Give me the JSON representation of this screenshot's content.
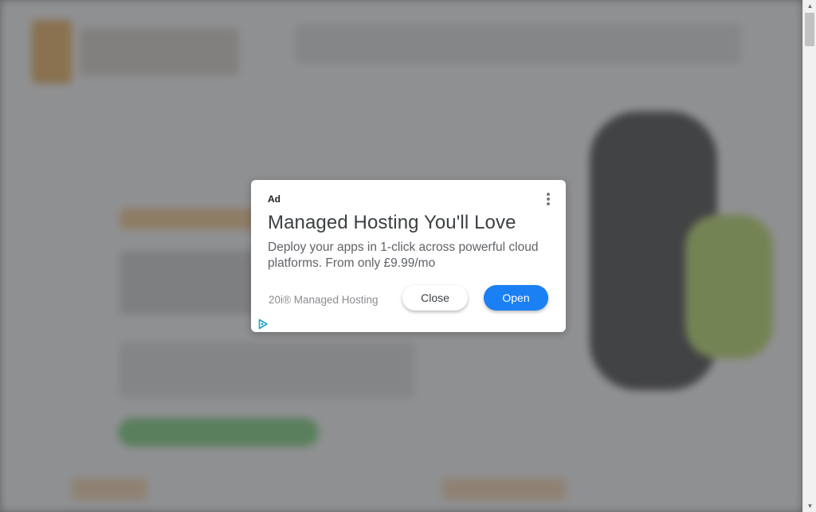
{
  "ad": {
    "label": "Ad",
    "title": "Managed Hosting You'll Love",
    "description": "Deploy your apps in 1-click across powerful cloud platforms. From only £9.99/mo",
    "advertiser": "20i® Managed Hosting",
    "close_label": "Close",
    "open_label": "Open"
  },
  "colors": {
    "open_button": "#1a80f3",
    "overlay": "#8c8e92",
    "adchoices": "#1fa4c4"
  },
  "icons": {
    "menu": "more-vertical-icon",
    "adchoices": "adchoices-icon",
    "scroll_up": "arrow-up-icon",
    "scroll_down": "arrow-down-icon"
  }
}
